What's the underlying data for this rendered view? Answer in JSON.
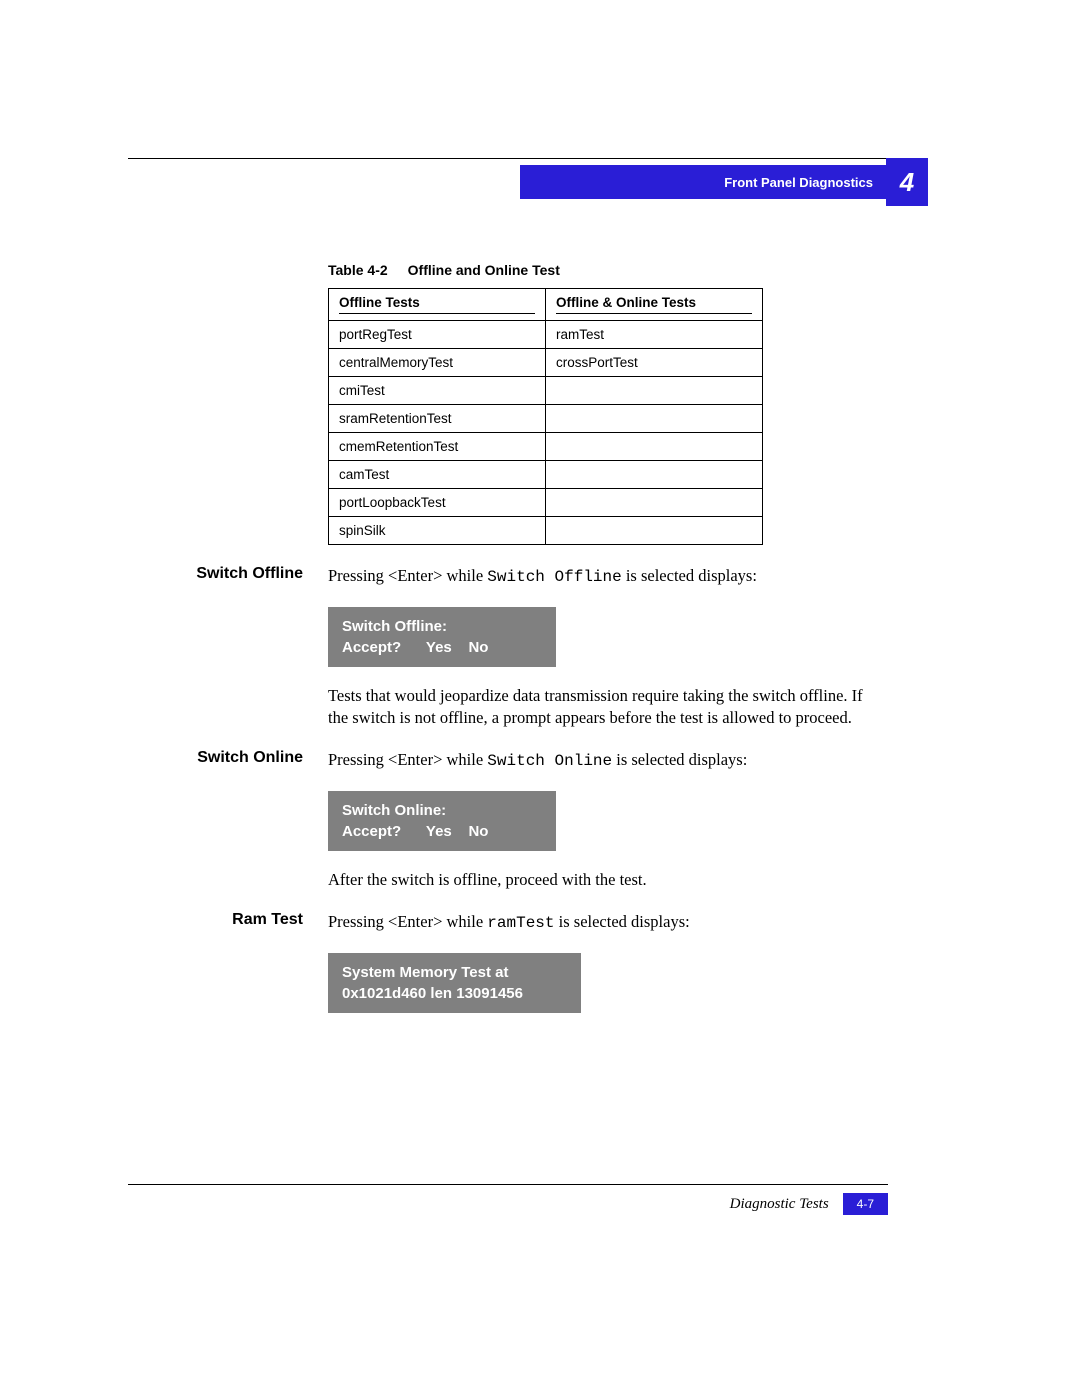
{
  "header": {
    "breadcrumb": "Front Panel Diagnostics",
    "chapter_num": "4"
  },
  "table": {
    "label_prefix": "Table 4-2",
    "title": "Offline and Online Test",
    "header_offline": "Offline Tests",
    "header_online": "Offline & Online Tests",
    "rows": [
      {
        "offline": "portRegTest",
        "online": "ramTest"
      },
      {
        "offline": "centralMemoryTest",
        "online": "crossPortTest"
      },
      {
        "offline": "cmiTest",
        "online": ""
      },
      {
        "offline": "sramRetentionTest",
        "online": ""
      },
      {
        "offline": "cmemRetentionTest",
        "online": ""
      },
      {
        "offline": "camTest",
        "online": ""
      },
      {
        "offline": "portLoopbackTest",
        "online": ""
      },
      {
        "offline": "spinSilk",
        "online": ""
      }
    ]
  },
  "sections": {
    "switch_offline": {
      "label": "Switch Offline",
      "intro_pre": "Pressing <Enter> while ",
      "intro_code": "Switch Offline",
      "intro_post": " is selected displays:",
      "display_line1": "Switch Offline:",
      "display_line2": "Accept?      Yes    No",
      "followup": "Tests that would jeopardize data transmission require taking the switch offline. If the switch is not offline, a prompt appears before the test is allowed to proceed."
    },
    "switch_online": {
      "label": "Switch Online",
      "intro_pre": "Pressing <Enter> while ",
      "intro_code": "Switch Online",
      "intro_post": " is selected displays:",
      "display_line1": "Switch Online:",
      "display_line2": "Accept?      Yes    No",
      "followup": "After the switch is offline, proceed with the test."
    },
    "ram_test": {
      "label": "Ram Test",
      "intro_pre": "Pressing <Enter> while ",
      "intro_code": "ramTest",
      "intro_post": " is selected displays:",
      "display_line1": "System Memory Test at",
      "display_line2": "0x1021d460 len 13091456"
    }
  },
  "footer": {
    "section": "Diagnostic Tests",
    "page": "4-7"
  }
}
